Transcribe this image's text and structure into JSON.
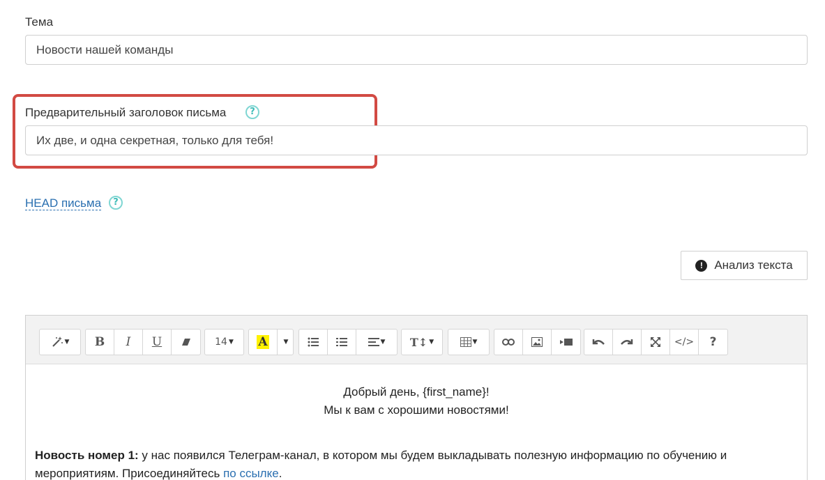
{
  "subject": {
    "label": "Тема",
    "value": "Новости нашей команды"
  },
  "preheader": {
    "label": "Предварительный заголовок письма",
    "value": "Их две, и одна секретная, только для тебя!",
    "help": "?"
  },
  "head_link": {
    "label": "HEAD письма",
    "help": "?"
  },
  "analyze_button": {
    "label": "Анализ текста",
    "icon": "exclamation-circle-icon"
  },
  "toolbar": {
    "font_size": "14",
    "bold": "B",
    "italic": "I",
    "underline": "U",
    "highlight": "A",
    "help": "?"
  },
  "body": {
    "greeting_line1": "Добрый день, {first_name}!",
    "greeting_line2": "Мы к вам с хорошими новостями!",
    "news_title": "Новость номер 1:",
    "news_text": " у нас появился Телеграм-канал, в котором мы будем выкладывать полезную информацию по обучению и мероприятиям. Присоединяйтесь ",
    "news_link": "по ссылке",
    "news_end": "."
  },
  "colors": {
    "highlight_border": "#d24a43",
    "help_icon": "#3fbcb8",
    "link": "#2a6fb0",
    "marker_yellow": "#fff200"
  }
}
